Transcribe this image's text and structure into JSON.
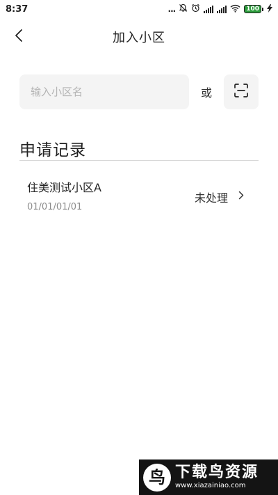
{
  "status_bar": {
    "time": "8:37",
    "dots": "...",
    "battery": "100",
    "icons": [
      "more-dots-icon",
      "mute-icon",
      "alarm-icon",
      "signal-icon",
      "signal-icon",
      "wifi-icon",
      "battery-icon",
      "charging-icon"
    ],
    "battery_color": "#2e9e3e"
  },
  "header": {
    "title": "加入小区",
    "back_icon": "chevron-left-icon"
  },
  "search": {
    "placeholder": "输入小区名",
    "value": "",
    "or_label": "或",
    "scan_icon": "scan-icon"
  },
  "records": {
    "title": "申请记录",
    "items": [
      {
        "name": "住美测试小区A",
        "date": "01/01/01/01",
        "status": "未处理",
        "arrow_icon": "chevron-right-icon"
      }
    ]
  },
  "watermark": {
    "name": "下载鸟资源",
    "url": "www.xiazainiao.com",
    "logo_icon": "bird-logo-icon"
  }
}
